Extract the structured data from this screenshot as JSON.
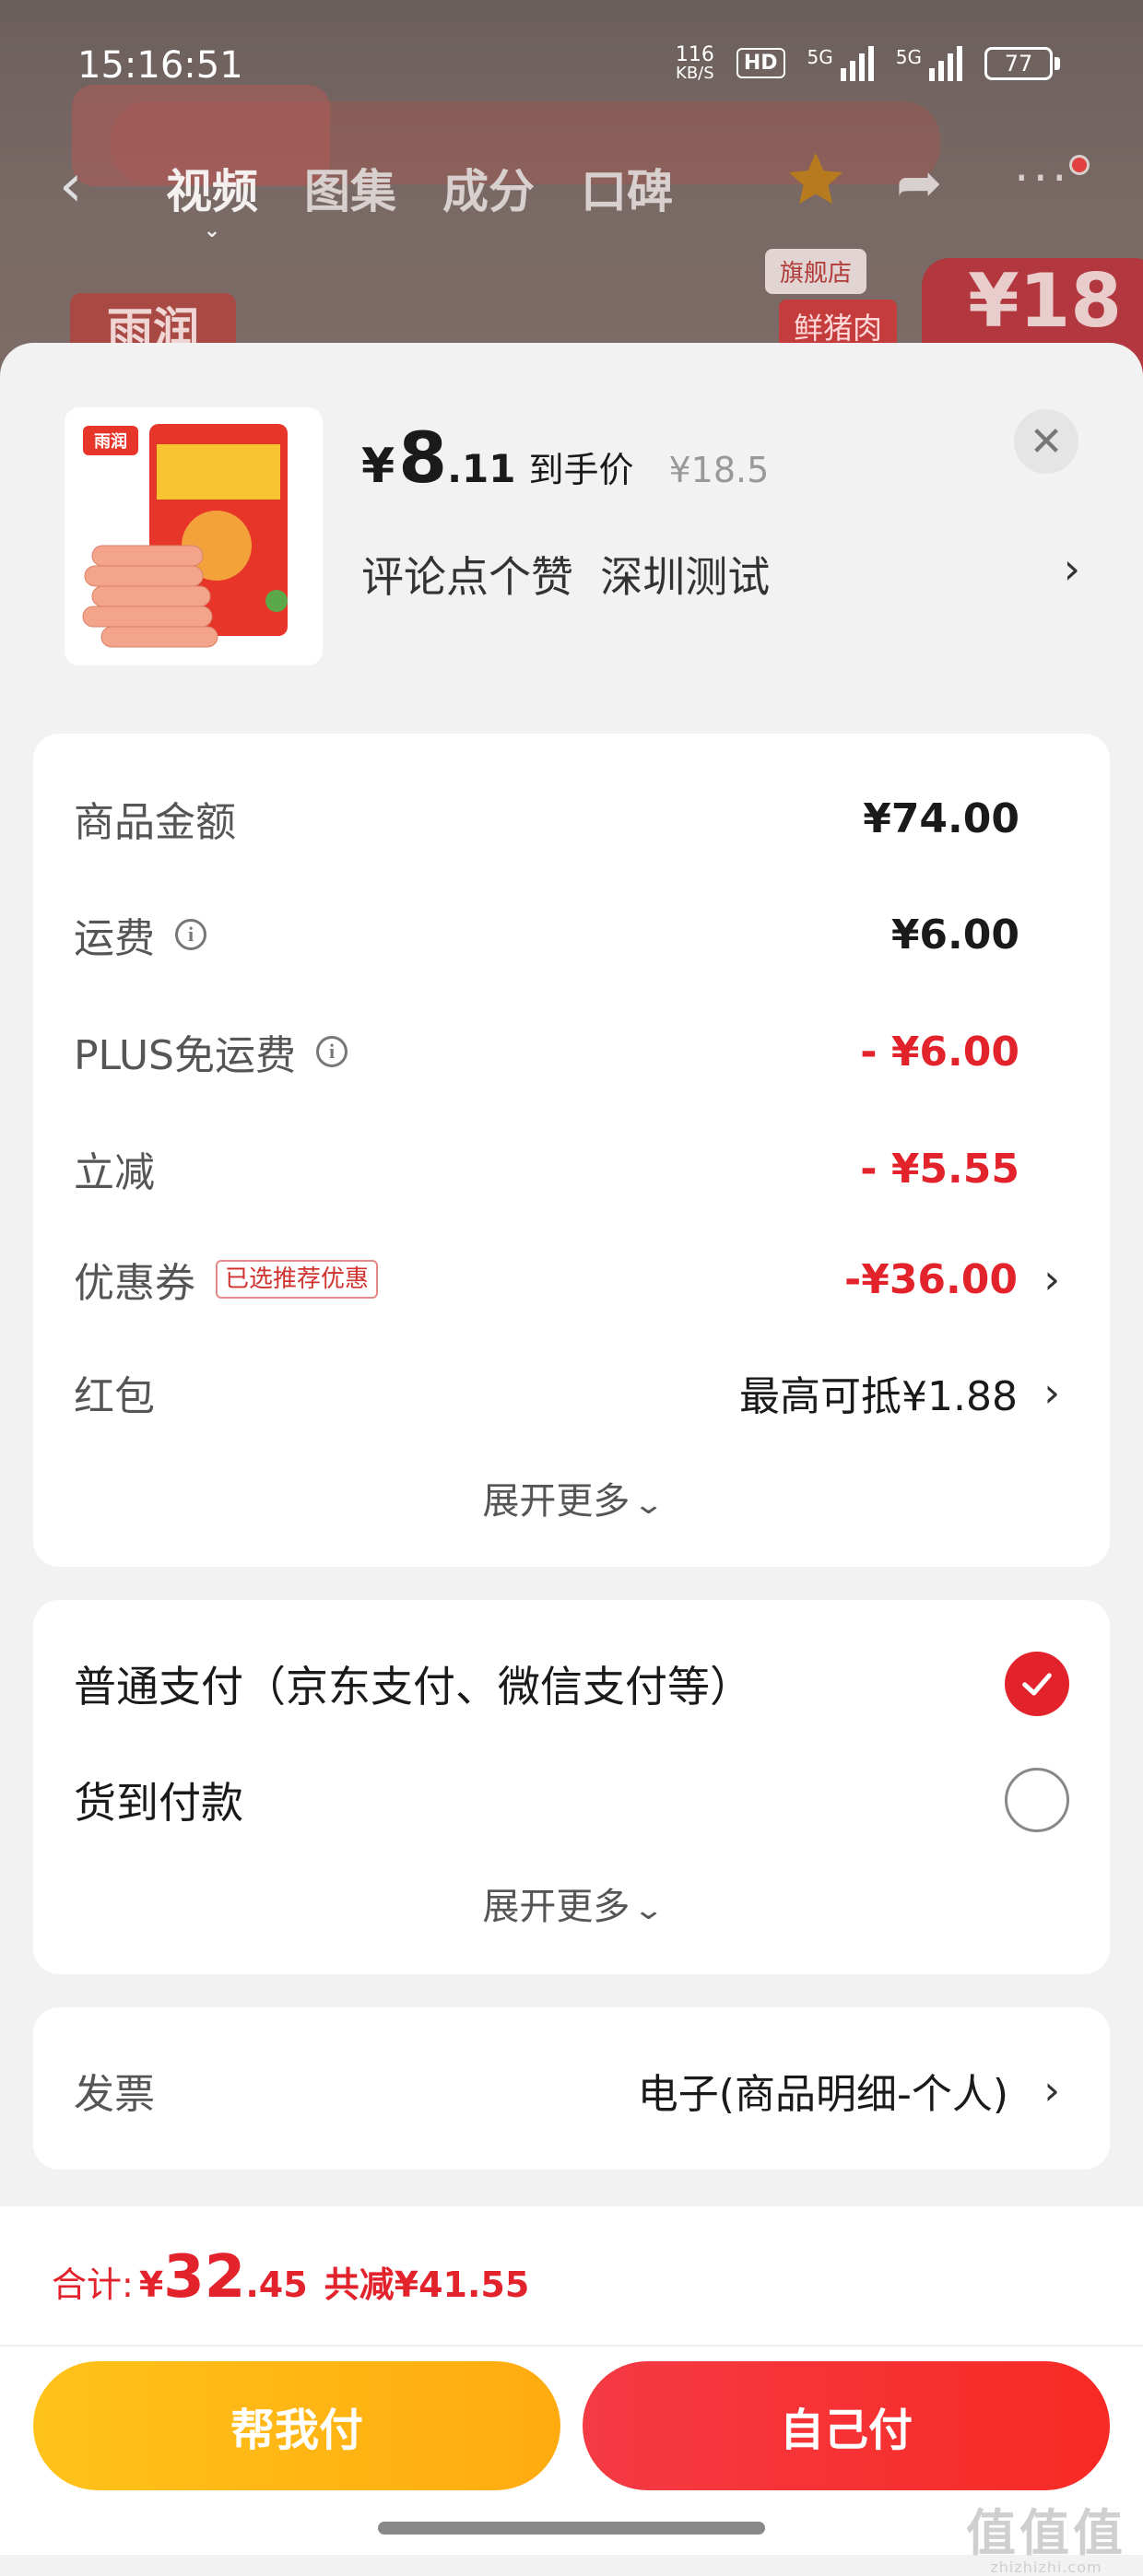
{
  "status_bar": {
    "time": "15:16:51",
    "net_speed_value": "116",
    "net_speed_unit": "KB/S",
    "hd_label": "HD",
    "signal1_label": "5G",
    "signal2_label": "5G",
    "battery": "77"
  },
  "background_page": {
    "tabs": [
      {
        "label": "视频",
        "active": true
      },
      {
        "label": "图集",
        "active": false
      },
      {
        "label": "成分",
        "active": false
      },
      {
        "label": "口碑",
        "active": false
      }
    ],
    "brand": "雨润",
    "store_badge": "旗舰店",
    "fresh_badge": "鲜猪肉",
    "price_peek": "¥18"
  },
  "product": {
    "thumb_brand": "雨润",
    "price_currency": "¥",
    "price_integer": "8",
    "price_decimal": ".11",
    "price_tag": "到手价",
    "original_price": "¥18.5",
    "spec": "评论点个赞  深圳测试"
  },
  "price_details": {
    "rows": [
      {
        "label": "商品金额",
        "value": "¥74.00"
      },
      {
        "label": "运费",
        "value": "¥6.00"
      },
      {
        "label": "PLUS免运费",
        "value": "- ¥6.00"
      },
      {
        "label": "立减",
        "value": "- ¥5.55"
      },
      {
        "label": "优惠券",
        "badge": "已选推荐优惠",
        "value": "-¥36.00"
      },
      {
        "label": "红包",
        "value": "最高可抵¥1.88"
      }
    ],
    "expand_label": "展开更多"
  },
  "payment": {
    "options": [
      {
        "label": "普通支付（京东支付、微信支付等）",
        "selected": true
      },
      {
        "label": "货到付款",
        "selected": false
      }
    ],
    "expand_label": "展开更多"
  },
  "invoice": {
    "label": "发票",
    "value": "电子(商品明细-个人)"
  },
  "footer": {
    "total_label": "合计:",
    "total_currency": "¥",
    "total_integer": "32",
    "total_decimal": ".45",
    "total_saved": "共减¥41.55",
    "btn_help": "帮我付",
    "btn_self": "自己付"
  },
  "watermark": {
    "line1": "值值值",
    "line2": "zhizhizhi.com"
  },
  "colors": {
    "accent_red": "#e3232c",
    "help_btn": "#ffb514",
    "self_btn": "#f5333a"
  }
}
